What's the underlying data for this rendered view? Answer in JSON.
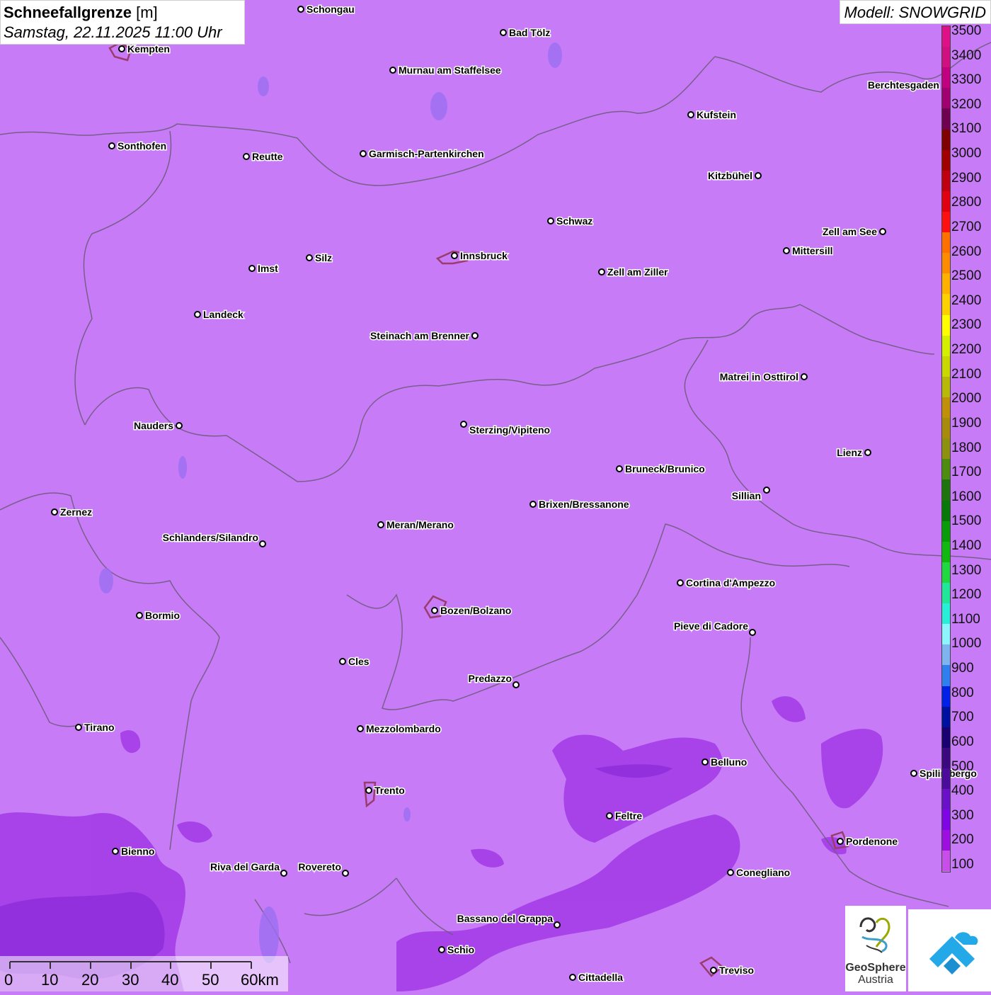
{
  "header": {
    "title_bold": "Schneefallgrenze",
    "title_unit": "[m]",
    "datetime": "Samstag, 22.11.2025 11:00 Uhr",
    "model": "Modell: SNOWGRID"
  },
  "legend": {
    "unit": "m",
    "colors": [
      "#c84ee9",
      "#9c0fe0",
      "#8005e6",
      "#6a10c8",
      "#4b0c9c",
      "#3b0880",
      "#1a0070",
      "#0010a0",
      "#0020e8",
      "#2f7fef",
      "#7eb5f0",
      "#8cf5ff",
      "#28f0d8",
      "#20e898",
      "#20d840",
      "#10b810",
      "#089c08",
      "#087808",
      "#207410",
      "#4e8c10",
      "#8e9010",
      "#a88a0c",
      "#c0900a",
      "#b8b808",
      "#c8d800",
      "#d4f000",
      "#ffff00",
      "#ffd000",
      "#ffb000",
      "#ff8c00",
      "#ff7000",
      "#ff1010",
      "#e00010",
      "#c00010",
      "#a00000",
      "#800000",
      "#700050",
      "#a00070",
      "#c00080",
      "#d01080",
      "#e01088"
    ],
    "labels": [
      "100",
      "200",
      "300",
      "400",
      "500",
      "600",
      "700",
      "800",
      "900",
      "1000",
      "1100",
      "1200",
      "1300",
      "1400",
      "1500",
      "1600",
      "1700",
      "1800",
      "1900",
      "2000",
      "2100",
      "2200",
      "2300",
      "2400",
      "2500",
      "2600",
      "2700",
      "2800",
      "2900",
      "3000",
      "3100",
      "3200",
      "3300",
      "3400",
      "3500"
    ]
  },
  "cities": [
    {
      "name": "Schongau"
    },
    {
      "name": "Bad Tölz"
    },
    {
      "name": "Kempten"
    },
    {
      "name": "Murnau am Staffelsee"
    },
    {
      "name": "Kufstein"
    },
    {
      "name": "Berchtesgaden"
    },
    {
      "name": "Sonthofen"
    },
    {
      "name": "Reutte"
    },
    {
      "name": "Garmisch-Partenkirchen"
    },
    {
      "name": "Kitzbühel"
    },
    {
      "name": "Schwaz"
    },
    {
      "name": "Zell am See"
    },
    {
      "name": "Innsbruck"
    },
    {
      "name": "Mittersill"
    },
    {
      "name": "Imst"
    },
    {
      "name": "Silz"
    },
    {
      "name": "Zell am Ziller"
    },
    {
      "name": "Landeck"
    },
    {
      "name": "Steinach am Brenner"
    },
    {
      "name": "Matrei in Osttirol"
    },
    {
      "name": "Nauders"
    },
    {
      "name": "Sterzing/Vipiteno"
    },
    {
      "name": "Lienz"
    },
    {
      "name": "Bruneck/Brunico"
    },
    {
      "name": "Sillian"
    },
    {
      "name": "Zernez"
    },
    {
      "name": "Brixen/Bressanone"
    },
    {
      "name": "Meran/Merano"
    },
    {
      "name": "Schlanders/Silandro"
    },
    {
      "name": "Cortina d'Ampezzo"
    },
    {
      "name": "Bormio"
    },
    {
      "name": "Bozen/Bolzano"
    },
    {
      "name": "Pieve di Cadore"
    },
    {
      "name": "Cles"
    },
    {
      "name": "Predazzo"
    },
    {
      "name": "Tirano"
    },
    {
      "name": "Mezzolombardo"
    },
    {
      "name": "Belluno"
    },
    {
      "name": "Spilimbergo"
    },
    {
      "name": "Trento"
    },
    {
      "name": "Feltre"
    },
    {
      "name": "Pordenone"
    },
    {
      "name": "Bienno"
    },
    {
      "name": "Riva del Garda"
    },
    {
      "name": "Rovereto"
    },
    {
      "name": "Conegliano"
    },
    {
      "name": "Bassano del Grappa"
    },
    {
      "name": "Schio"
    },
    {
      "name": "Treviso"
    },
    {
      "name": "Cittadella"
    }
  ],
  "scalebar": {
    "labels": [
      "0",
      "10",
      "20",
      "30",
      "40",
      "50",
      "60km"
    ]
  },
  "logos": {
    "geosphere_line1": "GeoSphere",
    "geosphere_line2": "Austria"
  }
}
